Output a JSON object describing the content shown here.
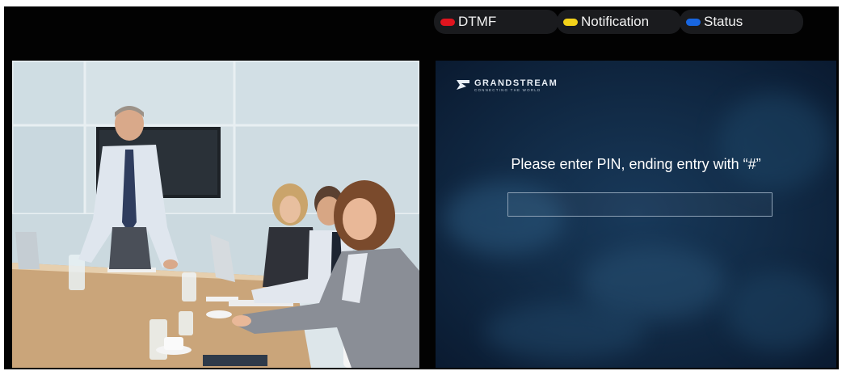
{
  "indicators": [
    {
      "label": "DTMF",
      "color": "#e0141e"
    },
    {
      "label": "Notification",
      "color": "#f3d21a"
    },
    {
      "label": "Status",
      "color": "#1866e0"
    }
  ],
  "brand": {
    "name": "GRANDSTREAM",
    "tagline": "CONNECTING THE WORLD"
  },
  "pin_screen": {
    "prompt": "Please enter PIN, ending entry with “#”",
    "pin_value": ""
  },
  "video_feed": {
    "description_icon": "conference-room-video"
  }
}
